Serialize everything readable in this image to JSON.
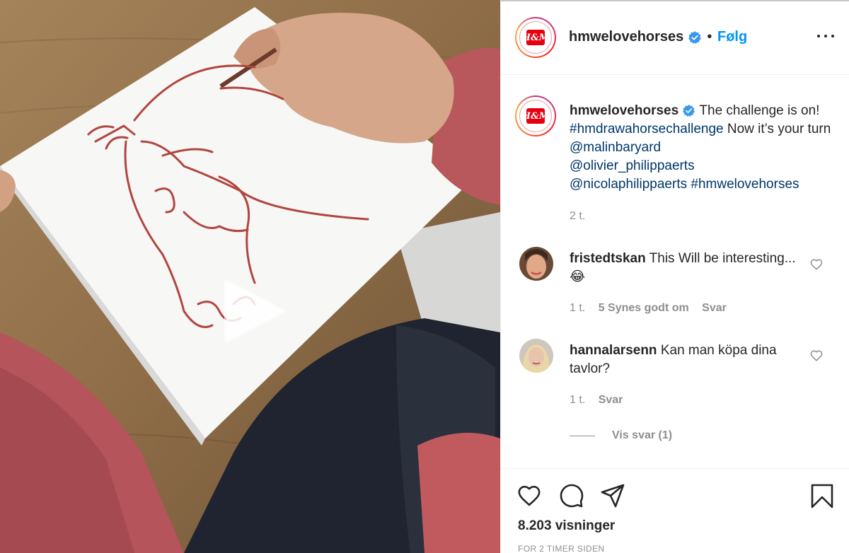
{
  "post": {
    "username": "hmwelovehorses",
    "separator": "•",
    "follow_label": "Følg",
    "avatar_text": "H&M",
    "caption": {
      "text_start": "The challenge is on!",
      "hashtag1": "#hmdrawahorsechallenge",
      "text_mid": "Now it’s your turn",
      "mention1": "@malinbaryard",
      "mention2": "@olivier_philippaerts",
      "mention3": "@nicolaphilippaerts",
      "hashtag2": "#hmwelovehorses",
      "time": "2 t."
    }
  },
  "comments": [
    {
      "username": "fristedtskan",
      "text": "This Will be interesting...😂",
      "time": "1 t.",
      "likes": "5 Synes godt om",
      "reply_label": "Svar"
    },
    {
      "username": "hannalarsenn",
      "text": "Kan man köpa dina tavlor?",
      "time": "1 t.",
      "reply_label": "Svar",
      "view_replies": "Vis svar (1)"
    }
  ],
  "footer": {
    "views": "8.203 visninger",
    "timestamp": "FOR 2 TIMER SIDEN"
  },
  "icons": [
    "verified-badge-icon",
    "more-options-icon",
    "play-icon",
    "heart-icon",
    "comment-icon",
    "share-icon",
    "bookmark-icon"
  ],
  "colors": {
    "link": "#00376b",
    "follow": "#0095f6",
    "verified": "#3897f0",
    "muted": "#8e8e8e",
    "brand_red": "#e50010"
  }
}
